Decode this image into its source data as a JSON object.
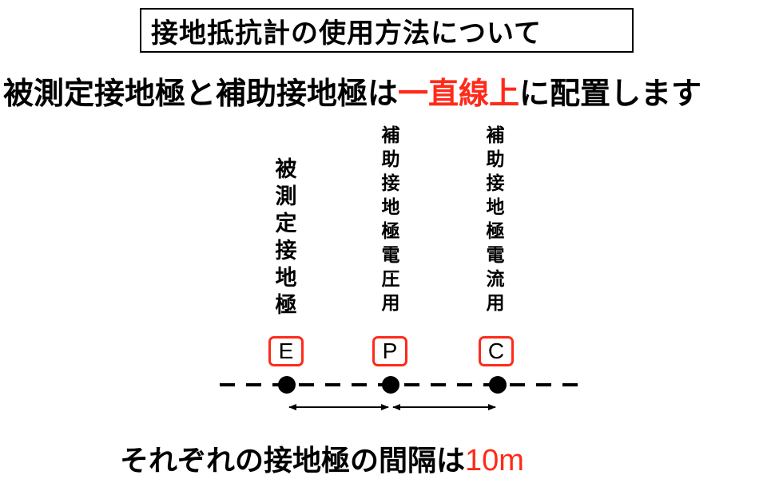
{
  "title": "接地抵抗計の使用方法について",
  "subtitle": {
    "before": "被測定接地極と補助接地極は",
    "highlight": "一直線上",
    "after": "に配置します"
  },
  "electrodes": [
    {
      "chars": [
        "被",
        "測",
        "定",
        "接",
        "地",
        "極"
      ],
      "letter": "E"
    },
    {
      "chars": [
        "補",
        "助",
        "接",
        "地",
        "極",
        "電",
        "圧",
        "用"
      ],
      "letter": "P"
    },
    {
      "chars": [
        "補",
        "助",
        "接",
        "地",
        "極",
        "電",
        "流",
        "用"
      ],
      "letter": "C"
    }
  ],
  "footer": {
    "text": "それぞれの接地極の間隔は",
    "distance": "10m"
  },
  "colors": {
    "accent": "#ff2a1a",
    "text": "#000000",
    "background": "#ffffff"
  }
}
